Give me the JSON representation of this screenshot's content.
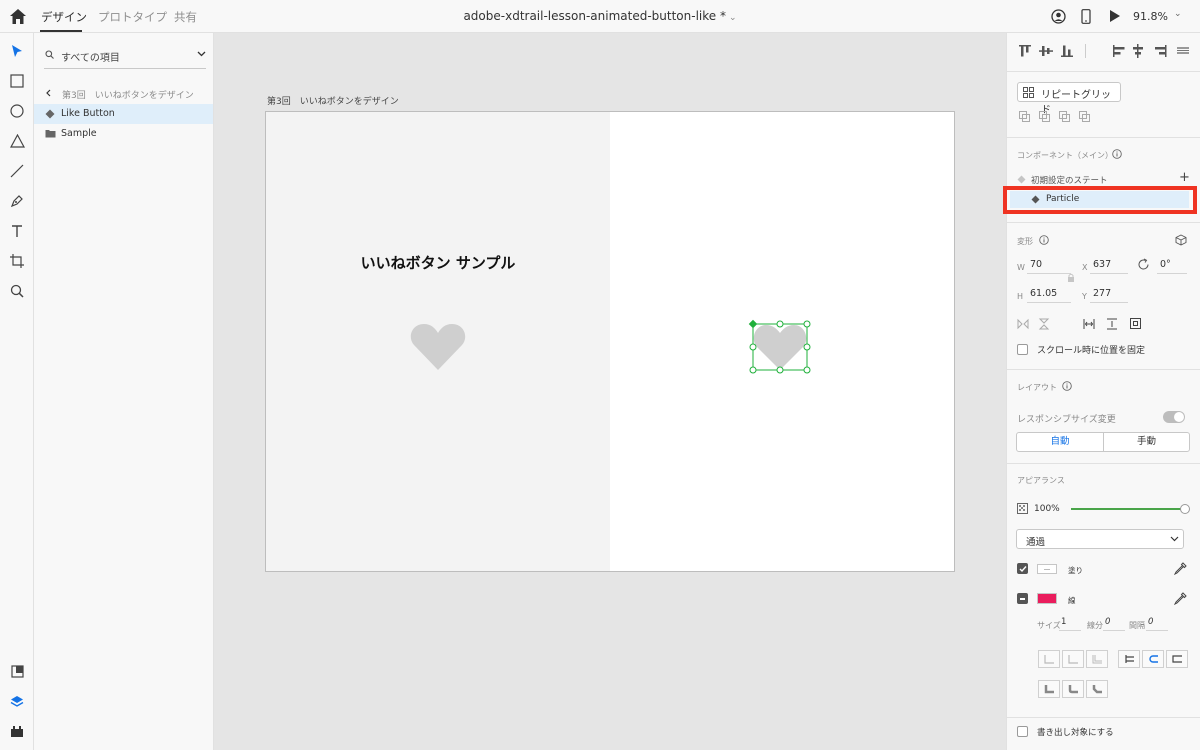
{
  "topbar": {
    "tabs": [
      "デザイン",
      "プロトタイプ",
      "共有"
    ],
    "doc_title": "adobe-xdtrail-lesson-animated-button-like *",
    "zoom": "91.8%",
    "dropdown_glyph": "⌄"
  },
  "layers": {
    "search_label": "すべての項目",
    "breadcrumb": "第3回　いいねボタンをデザイン",
    "items": [
      {
        "label": "Like Button",
        "icon": "component-diamond-icon",
        "selected": true
      },
      {
        "label": "Sample",
        "icon": "folder-icon",
        "selected": false
      }
    ]
  },
  "canvas": {
    "artboard_title": "第3回　いいねボタンをデザイン",
    "sample_title": "いいねボタン サンプル"
  },
  "props": {
    "repeat_grid": "リピートグリッド",
    "component_title": "コンポーネント（メイン）",
    "default_state": "初期設定のステート",
    "add_state": "+",
    "particle_state": "Particle",
    "transform_title": "変形",
    "w_label": "W",
    "w_value": "70",
    "x_label": "X",
    "x_value": "637",
    "h_label": "H",
    "h_value": "61.05",
    "y_label": "Y",
    "y_value": "277",
    "rotation": "0°",
    "fix_scroll": "スクロール時に位置を固定",
    "layout_title": "レイアウト",
    "responsive": "レスポンシブサイズ変更",
    "auto": "自動",
    "manual": "手動",
    "appearance_title": "アピアランス",
    "opacity": "100%",
    "blend_mode": "通過",
    "fill_label": "塗り",
    "stroke_label": "線",
    "size_label": "サイズ",
    "size_value": "1",
    "dash_label": "線分",
    "dash_value": "0",
    "gap_label": "間隔",
    "gap_value": "0",
    "export": "書き出し対象にする",
    "stroke_color": "#ea1d5d",
    "accent_color": "#1473e6",
    "highlight_color": "#ef3322"
  }
}
